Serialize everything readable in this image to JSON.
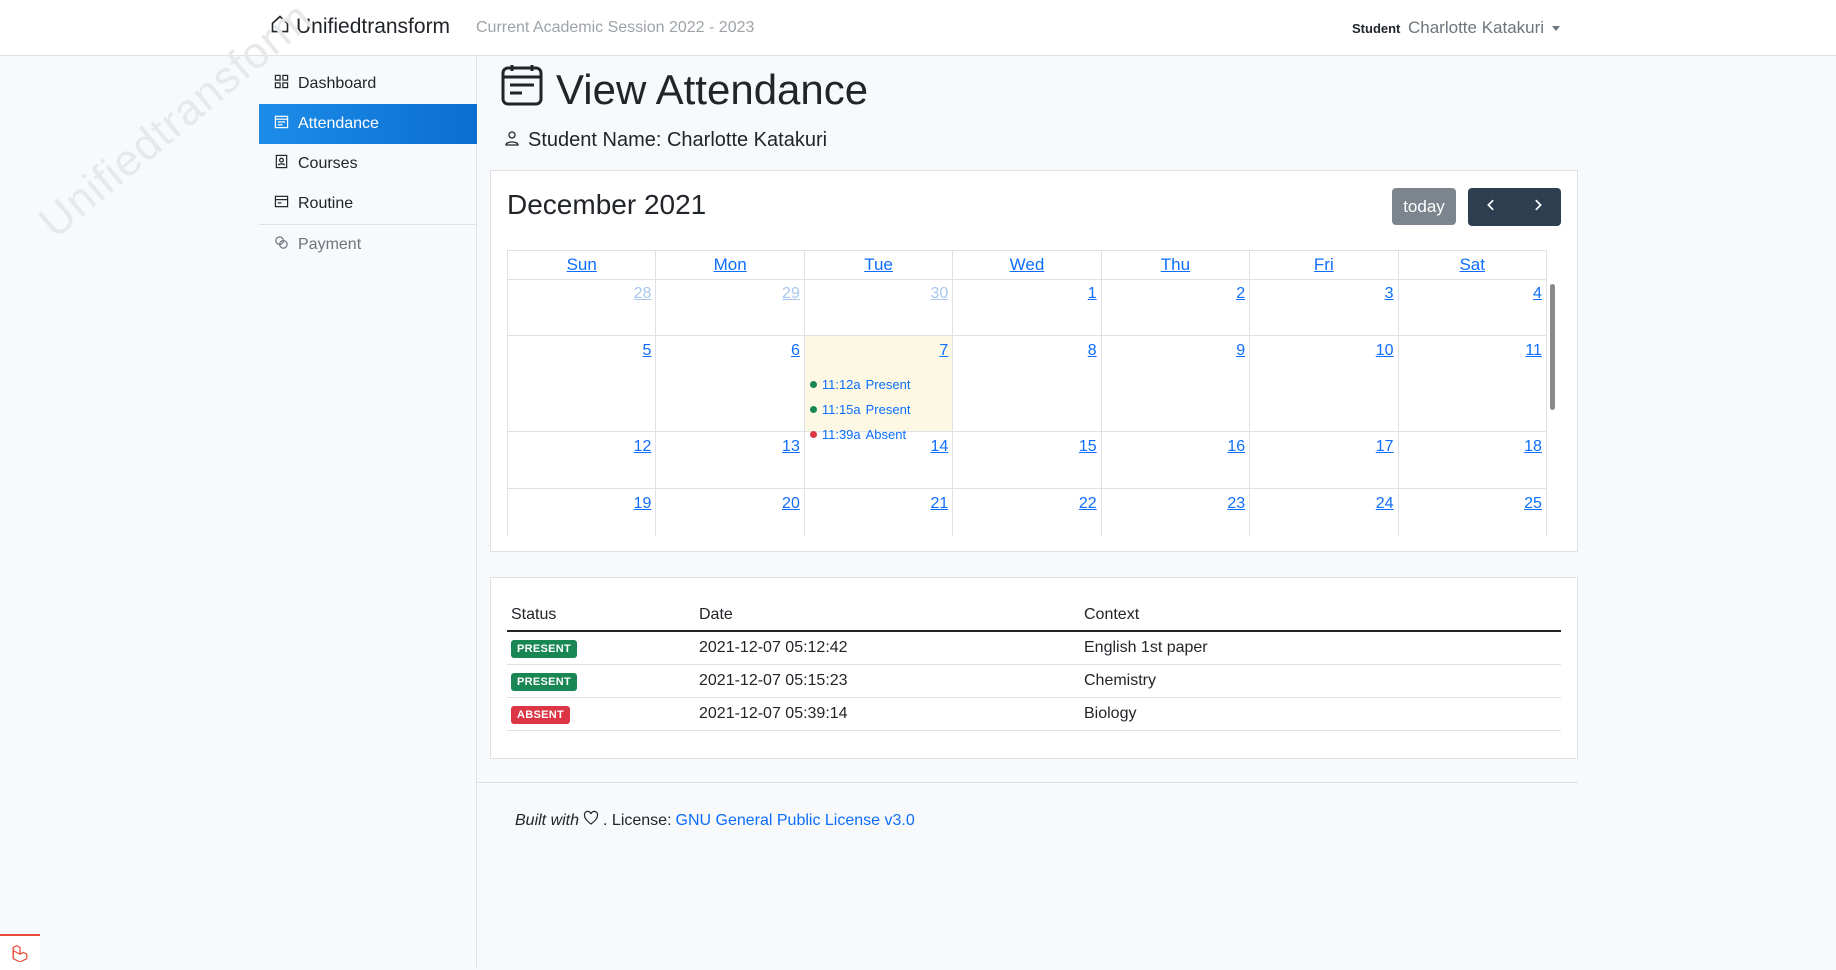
{
  "navbar": {
    "brand": "Unifiedtransform",
    "session": "Current Academic Session 2022 - 2023",
    "role": "Student",
    "user": "Charlotte Katakuri"
  },
  "sidebar": {
    "items": [
      {
        "label": "Dashboard",
        "icon": "grid-icon"
      },
      {
        "label": "Attendance",
        "icon": "calendar-icon",
        "active": true
      },
      {
        "label": "Courses",
        "icon": "person-card-icon"
      },
      {
        "label": "Routine",
        "icon": "calendar-list-icon"
      },
      {
        "label": "Payment",
        "icon": "coins-icon"
      }
    ],
    "watermark": "Unifiedtransform"
  },
  "page": {
    "title": "View Attendance",
    "student_label": "Student Name: Charlotte Katakuri"
  },
  "calendar": {
    "title": "December 2021",
    "today_label": "today",
    "days_of_week": [
      "Sun",
      "Mon",
      "Tue",
      "Wed",
      "Thu",
      "Fri",
      "Sat"
    ],
    "weeks": [
      {
        "days": [
          {
            "n": "28",
            "other": true
          },
          {
            "n": "29",
            "other": true
          },
          {
            "n": "30",
            "other": true
          },
          {
            "n": "1"
          },
          {
            "n": "2"
          },
          {
            "n": "3"
          },
          {
            "n": "4"
          }
        ]
      },
      {
        "days": [
          {
            "n": "5"
          },
          {
            "n": "6"
          },
          {
            "n": "7",
            "today": true
          },
          {
            "n": "8"
          },
          {
            "n": "9"
          },
          {
            "n": "10"
          },
          {
            "n": "11"
          }
        ]
      },
      {
        "days": [
          {
            "n": "12"
          },
          {
            "n": "13"
          },
          {
            "n": "14"
          },
          {
            "n": "15"
          },
          {
            "n": "16"
          },
          {
            "n": "17"
          },
          {
            "n": "18"
          }
        ]
      },
      {
        "days": [
          {
            "n": "19"
          },
          {
            "n": "20"
          },
          {
            "n": "21"
          },
          {
            "n": "22"
          },
          {
            "n": "23"
          },
          {
            "n": "24"
          },
          {
            "n": "25"
          }
        ]
      }
    ],
    "events": [
      {
        "time": "11:12a",
        "label": "Present",
        "color": "#198754"
      },
      {
        "time": "11:15a",
        "label": "Present",
        "color": "#198754"
      },
      {
        "time": "11:39a",
        "label": "Absent",
        "color": "#dc3545"
      }
    ]
  },
  "attendance_table": {
    "headers": [
      "Status",
      "Date",
      "Context"
    ],
    "rows": [
      {
        "status": "PRESENT",
        "status_color": "#198754",
        "date": "2021-12-07 05:12:42",
        "context": "English 1st paper"
      },
      {
        "status": "PRESENT",
        "status_color": "#198754",
        "date": "2021-12-07 05:15:23",
        "context": "Chemistry"
      },
      {
        "status": "ABSENT",
        "status_color": "#dc3545",
        "date": "2021-12-07 05:39:14",
        "context": "Biology"
      }
    ]
  },
  "footer": {
    "built_with": "Built with",
    "license_prefix": ". License:",
    "license_link": "GNU General Public License v3.0"
  }
}
